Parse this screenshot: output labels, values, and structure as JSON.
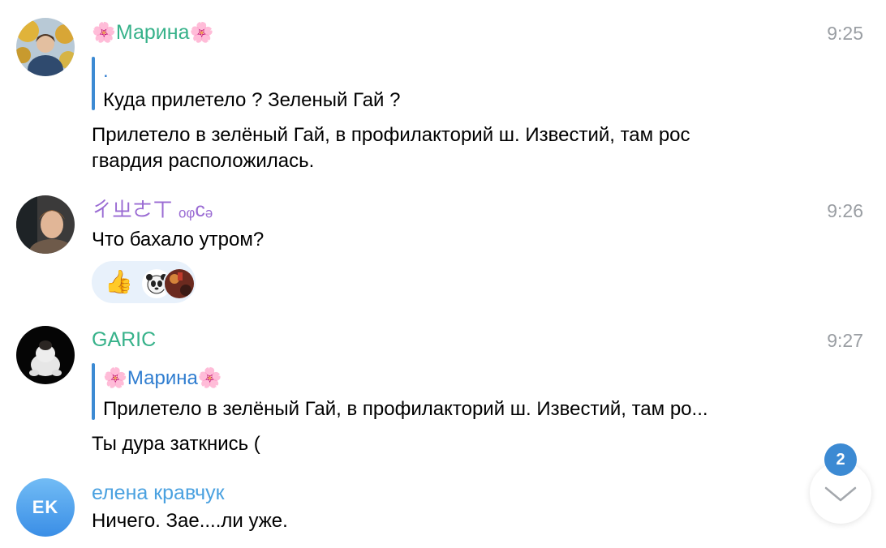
{
  "messages": [
    {
      "author": "Марина",
      "flower": "🌸",
      "time": "9:25",
      "reply": {
        "name": ".",
        "text": "Куда прилетело ? Зеленый Гай ?"
      },
      "lines": [
        "Прилетело в зелёный Гай, в профилакторий ш. Известий, там рос",
        "гвардия расположилась."
      ]
    },
    {
      "author": "ㄔㄓㄜㄒ ₒᵩcₔ",
      "time": "9:26",
      "text": "Что бахало утром?",
      "reaction": {
        "emoji": "👍"
      }
    },
    {
      "author": "GARIC",
      "time": "9:27",
      "reply": {
        "name": "Марина",
        "flower": "🌸",
        "text": "Прилетело в зелёный Гай, в профилакторий ш. Известий, там ро..."
      },
      "text": "Ты дура заткнись ("
    },
    {
      "author": "елена кравчук",
      "initials": "EK",
      "text": "Ничего. Зае....ли уже."
    }
  ],
  "scroll": {
    "unread_count": "2",
    "icon": "chevron-down-icon"
  },
  "colors": {
    "green_name": "#37b28a",
    "purple_name": "#9a6bd3",
    "blue_name": "#4aa1e0",
    "reply_bar": "#3c8ad3",
    "reply_name": "#2f7dd0",
    "time": "#9a9ea3",
    "badge": "#3c8ad3"
  }
}
